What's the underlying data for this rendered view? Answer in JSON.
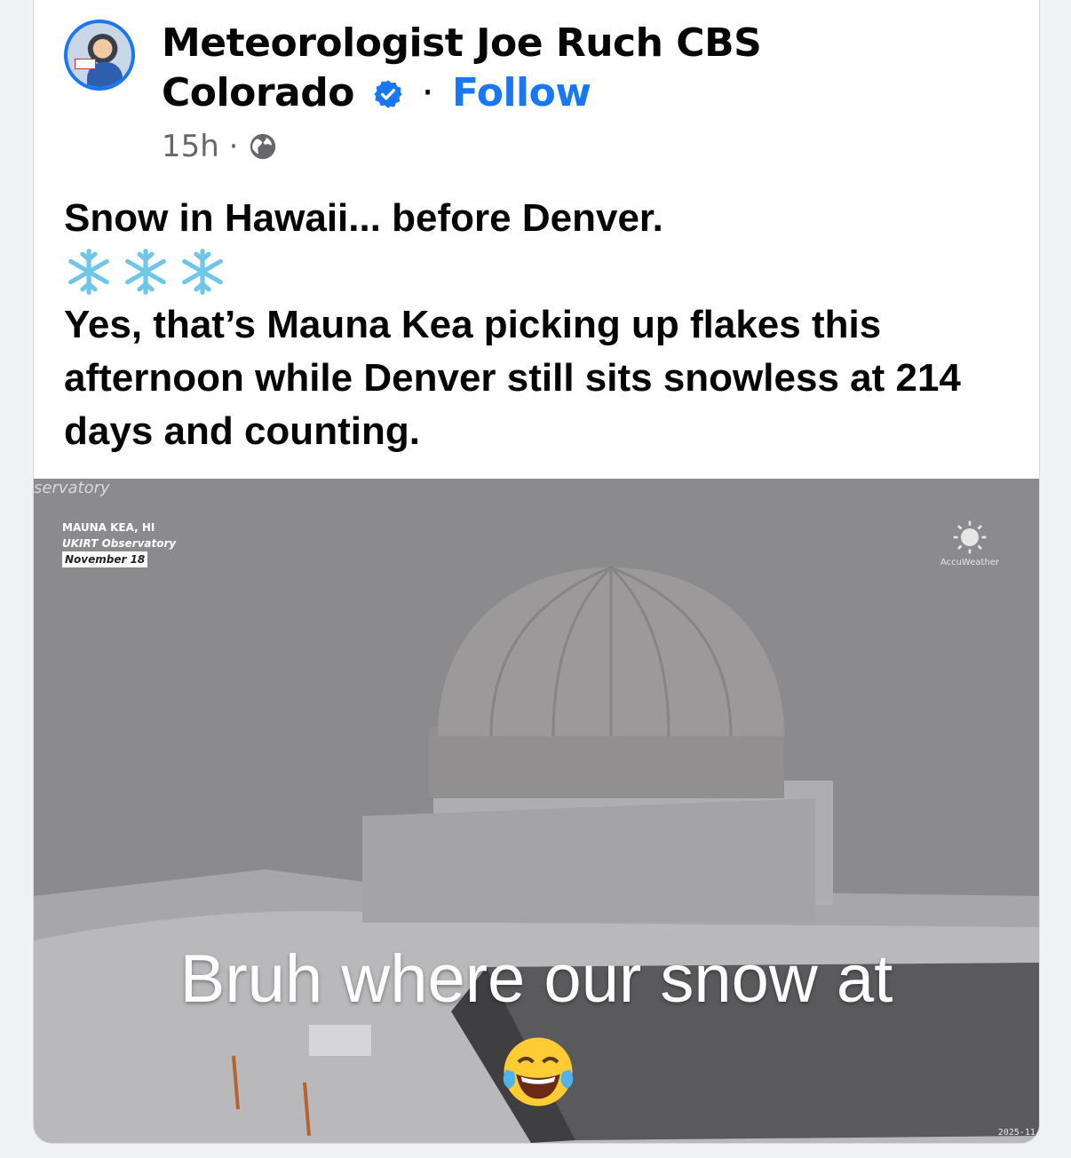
{
  "post": {
    "author": {
      "name": "Meteorologist Joe Ruch CBS Colorado",
      "verified": true,
      "follow_label": "Follow",
      "separator": "·"
    },
    "meta": {
      "time": "15h",
      "separator": "·",
      "audience_icon": "globe-icon"
    },
    "text": {
      "line1": "Snow in Hawaii... before Denver.",
      "emoji": [
        "❄️",
        "❄️",
        "❄️"
      ],
      "line2": "Yes, that’s Mauna Kea picking up flakes this afternoon while Denver still sits snowless at 214 days and counting."
    },
    "media": {
      "watermark_top": "servatory",
      "location_line1": "MAUNA KEA, HI",
      "location_line2": "UKIRT Observatory",
      "location_line3": "November 18",
      "brand": "AccuWeather",
      "caption": "Bruh where our snow at",
      "caption_emoji": "face-with-tears-of-joy",
      "timestamp": "2025-11"
    }
  },
  "colors": {
    "accent": "#1877f2",
    "text": "#050505",
    "secondary": "#65676b",
    "flake": "#6ec6e8"
  }
}
